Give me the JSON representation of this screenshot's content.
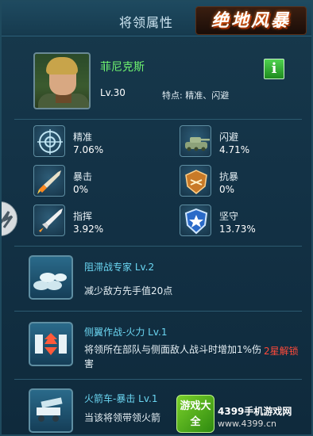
{
  "header": {
    "title": "将领属性",
    "logo_text": "绝地风暴"
  },
  "commander": {
    "name": "菲尼克斯",
    "level": "Lv.30",
    "traits": "特点: 精准、闪避",
    "info_label": "i"
  },
  "stats": [
    {
      "label": "精准",
      "value": "7.06%",
      "icon": "crosshair-icon"
    },
    {
      "label": "闪避",
      "value": "4.71%",
      "icon": "tank-icon"
    },
    {
      "label": "暴击",
      "value": "0%",
      "icon": "rocket-icon"
    },
    {
      "label": "抗暴",
      "value": "0%",
      "icon": "shield-badge-icon"
    },
    {
      "label": "指挥",
      "value": "3.92%",
      "icon": "missile-icon"
    },
    {
      "label": "坚守",
      "value": "13.73%",
      "icon": "star-shield-icon"
    }
  ],
  "skills": [
    {
      "name": "阻滞战专家 Lv.2",
      "desc": "减少敌方先手值20点",
      "icon": "sandbag-icon"
    },
    {
      "name": "侧翼作战-火力 Lv.1",
      "desc": "将领所在部队与侧面敌人战斗时增加1%伤害",
      "icon": "flank-fire-icon",
      "lock_text": "2星解锁"
    },
    {
      "name": "火箭车-暴击 Lv.1",
      "desc": "当该将领带领火箭",
      "icon": "rocket-truck-icon"
    }
  ],
  "watermark": {
    "badge": "游戏大全",
    "site_name": "4399手机游戏网",
    "url": "www.4399.cn"
  },
  "colors": {
    "accent_green": "#6ff26f",
    "skill_blue": "#6bd6f2",
    "lock_red": "#ff4a3a"
  }
}
